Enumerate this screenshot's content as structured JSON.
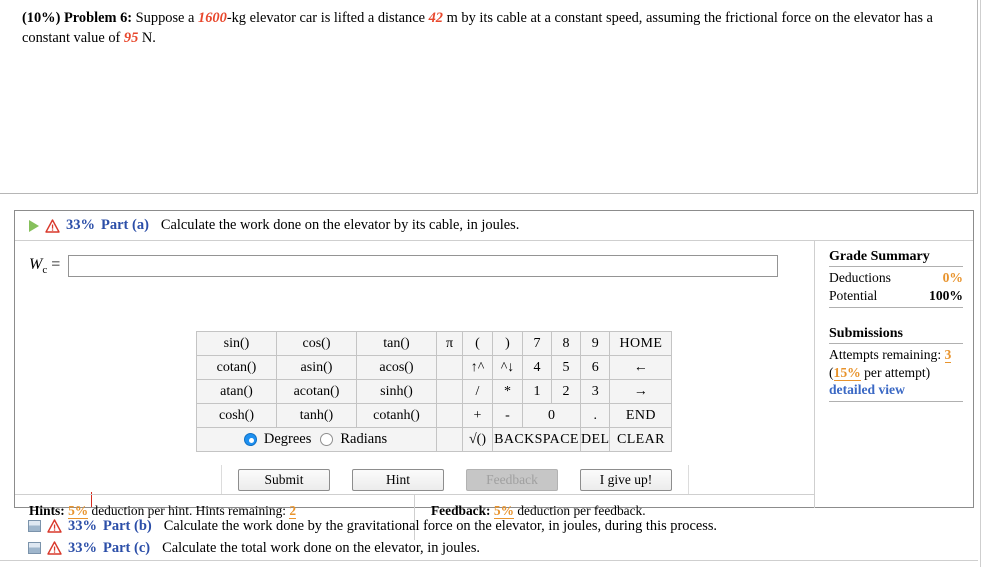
{
  "problem": {
    "percent": "(10%)",
    "label": "Problem 6:",
    "text_1": "Suppose a ",
    "mass": "1600",
    "text_2": "-kg elevator car is lifted a distance ",
    "distance": "42",
    "text_3": " m by its cable at a constant speed, assuming the frictional force on the elevator has a constant value of ",
    "friction": "95",
    "text_4": " N."
  },
  "part_a": {
    "expand_icon": "play-triangle-icon",
    "warning_icon": "warning-triangle-icon",
    "percent": "33%",
    "name": "Part (a)",
    "description": "Calculate the work done on the elevator by its cable, in joules.",
    "answer_label_var": "W",
    "answer_label_sub": "c",
    "answer_label_eq": "=",
    "answer_value": "",
    "answer_placeholder": ""
  },
  "keypad": {
    "rows": [
      [
        {
          "label": "sin()",
          "type": "fn",
          "disabled": false
        },
        {
          "label": "cos()",
          "type": "fn",
          "disabled": false
        },
        {
          "label": "tan()",
          "type": "fn",
          "disabled": false
        },
        {
          "label": "π",
          "type": "pi",
          "disabled": false
        },
        {
          "label": "(",
          "type": "op",
          "disabled": false
        },
        {
          "label": ")",
          "type": "op",
          "disabled": true
        },
        {
          "label": "7",
          "type": "dig",
          "disabled": false
        },
        {
          "label": "8",
          "type": "dig",
          "disabled": false
        },
        {
          "label": "9",
          "type": "dig",
          "disabled": false
        },
        {
          "label": "HOME",
          "type": "nav",
          "disabled": true
        }
      ],
      [
        {
          "label": "cotan()",
          "type": "fn",
          "disabled": false
        },
        {
          "label": "asin()",
          "type": "fn",
          "disabled": false
        },
        {
          "label": "acos()",
          "type": "fn",
          "disabled": false
        },
        {
          "label": "",
          "type": "pi",
          "disabled": true
        },
        {
          "label": "↑^",
          "type": "op",
          "disabled": true
        },
        {
          "label": "^↓",
          "type": "op",
          "disabled": true
        },
        {
          "label": "4",
          "type": "dig",
          "disabled": false
        },
        {
          "label": "5",
          "type": "dig",
          "disabled": false
        },
        {
          "label": "6",
          "type": "dig",
          "disabled": false
        },
        {
          "label": "←",
          "type": "nav",
          "disabled": true
        }
      ],
      [
        {
          "label": "atan()",
          "type": "fn",
          "disabled": false
        },
        {
          "label": "acotan()",
          "type": "fn",
          "disabled": false
        },
        {
          "label": "sinh()",
          "type": "fn",
          "disabled": false
        },
        {
          "label": "",
          "type": "pi",
          "disabled": true
        },
        {
          "label": "/",
          "type": "op",
          "disabled": true
        },
        {
          "label": "*",
          "type": "op",
          "disabled": false
        },
        {
          "label": "1",
          "type": "dig",
          "disabled": false
        },
        {
          "label": "2",
          "type": "dig",
          "disabled": false
        },
        {
          "label": "3",
          "type": "dig",
          "disabled": false
        },
        {
          "label": "→",
          "type": "nav",
          "disabled": true
        }
      ],
      [
        {
          "label": "cosh()",
          "type": "fn",
          "disabled": false
        },
        {
          "label": "tanh()",
          "type": "fn",
          "disabled": false
        },
        {
          "label": "cotanh()",
          "type": "fn",
          "disabled": false
        },
        {
          "label": "",
          "type": "pi",
          "disabled": true
        },
        {
          "label": "+",
          "type": "op",
          "disabled": false
        },
        {
          "label": "-",
          "type": "op",
          "disabled": false
        },
        {
          "label": "0",
          "type": "zero",
          "disabled": false
        },
        {
          "label": ".",
          "type": "dig",
          "disabled": false
        },
        {
          "label": "END",
          "type": "nav",
          "disabled": true
        }
      ]
    ],
    "last_row": [
      {
        "label": "",
        "type": "pi",
        "disabled": true
      },
      {
        "label": "√()",
        "type": "op",
        "disabled": false
      },
      {
        "label": "BACKSPACE",
        "type": "bksp",
        "disabled": true
      },
      {
        "label": "DEL",
        "type": "del",
        "disabled": true
      },
      {
        "label": "CLEAR",
        "type": "nav",
        "disabled": true
      }
    ],
    "angle_mode": {
      "degrees_label": "Degrees",
      "radians_label": "Radians",
      "selected": "Degrees"
    }
  },
  "buttons": {
    "submit": "Submit",
    "hint": "Hint",
    "feedback": "Feedback",
    "give_up": "I give up!"
  },
  "hints": {
    "title": "Hints:",
    "deduction": "5%",
    "text_mid": " deduction per hint. Hints remaining: ",
    "remaining": "2"
  },
  "feedback": {
    "title": "Feedback:",
    "deduction": "5%",
    "text_mid": " deduction per feedback."
  },
  "grade_summary": {
    "title": "Grade Summary",
    "deductions_label": "Deductions",
    "deductions_value": "0%",
    "potential_label": "Potential",
    "potential_value": "100%",
    "submissions_title": "Submissions",
    "attempts_label": "Attempts remaining: ",
    "attempts_value": "3",
    "per_attempt_open": "(",
    "per_attempt_pct": "15%",
    "per_attempt_close": " per attempt)",
    "detailed_view": "detailed view"
  },
  "part_b": {
    "collapse_icon": "collapsed-square-icon",
    "warning_icon": "warning-triangle-icon",
    "percent": "33%",
    "name": "Part (b)",
    "description": "Calculate the work done by the gravitational force on the elevator, in joules, during this process."
  },
  "part_c": {
    "collapse_icon": "collapsed-square-icon",
    "warning_icon": "warning-triangle-icon",
    "percent": "33%",
    "name": "Part (c)",
    "description": "Calculate the total work done on the elevator, in joules."
  },
  "colors": {
    "accent_blue": "#2b4ea8",
    "value_red": "#e8472c",
    "orange": "#e8932c",
    "link_blue": "#3a68c4"
  }
}
